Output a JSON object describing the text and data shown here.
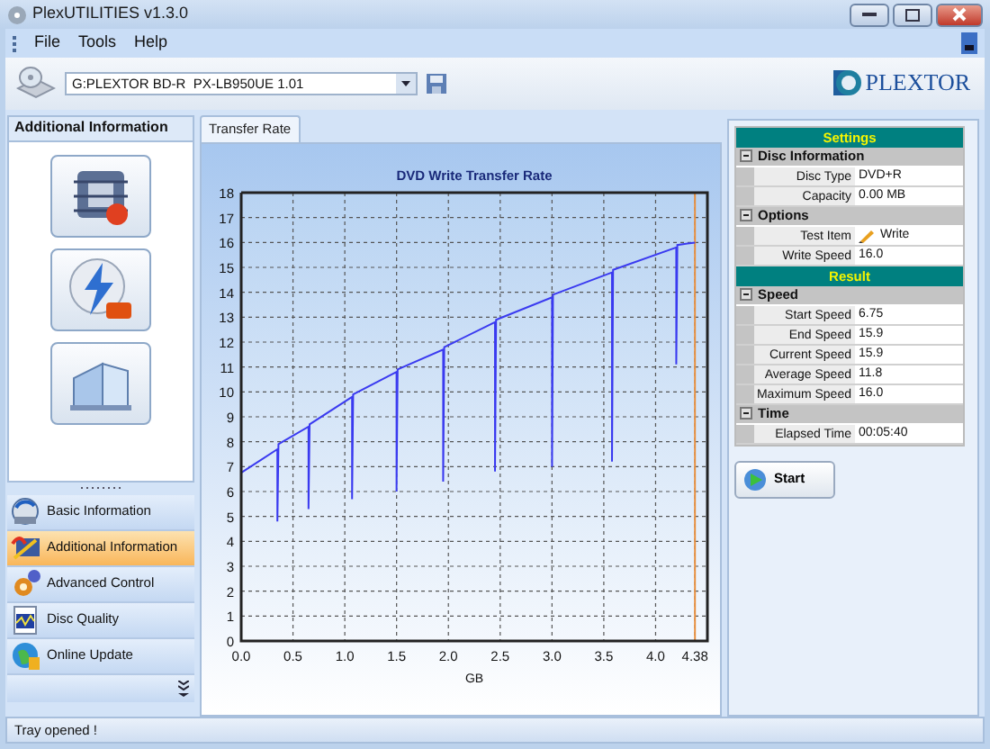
{
  "window": {
    "title": "PlexUTILITIES v1.3.0"
  },
  "menu": [
    "File",
    "Tools",
    "Help"
  ],
  "toolbar": {
    "drive": "G:PLEXTOR BD-R  PX-LB950UE 1.01",
    "logo": "PLEXTOR"
  },
  "sidebar": {
    "title": "Additional Information",
    "items": [
      {
        "label": "Basic Information",
        "selected": false
      },
      {
        "label": "Additional Information",
        "selected": true
      },
      {
        "label": "Advanced Control",
        "selected": false
      },
      {
        "label": "Disc Quality",
        "selected": false
      },
      {
        "label": "Online Update",
        "selected": false
      }
    ]
  },
  "tabs": [
    {
      "label": "Transfer Rate",
      "selected": true
    }
  ],
  "chart_data": {
    "type": "line",
    "title": "DVD Write Transfer Rate",
    "xlabel": "GB",
    "x": [
      0,
      0.35,
      0.35,
      0.36,
      0.65,
      0.65,
      0.66,
      1.07,
      1.07,
      1.08,
      1.5,
      1.5,
      1.51,
      1.95,
      1.95,
      1.96,
      2.45,
      2.45,
      2.46,
      3.0,
      3.0,
      3.01,
      3.58,
      3.58,
      3.59,
      4.2,
      4.2,
      4.21,
      4.38
    ],
    "values": [
      6.75,
      7.7,
      4.8,
      7.9,
      8.6,
      5.3,
      8.7,
      9.8,
      5.7,
      9.9,
      10.8,
      6.0,
      10.9,
      11.7,
      6.4,
      11.8,
      12.8,
      6.8,
      12.9,
      13.8,
      7.0,
      13.9,
      14.8,
      7.2,
      14.9,
      15.8,
      11.1,
      15.9,
      16.0
    ],
    "grid": true,
    "xlim": [
      0,
      4.5
    ],
    "ylim": [
      0,
      18
    ],
    "xticks": [
      {
        "value": 0,
        "label": "0.0"
      },
      {
        "value": 0.5,
        "label": "0.5"
      },
      {
        "value": 1,
        "label": "1.0"
      },
      {
        "value": 1.5,
        "label": "1.5"
      },
      {
        "value": 2,
        "label": "2.0"
      },
      {
        "value": 2.5,
        "label": "2.5"
      },
      {
        "value": 3,
        "label": "3.0"
      },
      {
        "value": 3.5,
        "label": "3.5"
      },
      {
        "value": 4,
        "label": "4.0"
      },
      {
        "value": 4.38,
        "label": "4.38"
      }
    ],
    "yticks": [
      0,
      1,
      2,
      3,
      4,
      5,
      6,
      7,
      8,
      9,
      10,
      11,
      12,
      13,
      14,
      15,
      16,
      17,
      18
    ],
    "ref_lines": [
      {
        "axis": "x",
        "value": 4.38
      }
    ]
  },
  "panels": [
    {
      "title": "Settings",
      "groups": [
        {
          "title": "Disc Information",
          "expanded": true,
          "rows": [
            {
              "kind": "text",
              "label": "Disc Type",
              "value": "DVD+R"
            },
            {
              "kind": "text",
              "label": "Capacity",
              "value": "0.00 MB"
            }
          ]
        },
        {
          "title": "Options",
          "expanded": true,
          "rows": [
            {
              "kind": "icon",
              "label": "Test Item",
              "value": "Write"
            },
            {
              "kind": "text",
              "label": "Write Speed",
              "value": "16.0"
            }
          ]
        }
      ]
    },
    {
      "title": "Result",
      "groups": [
        {
          "title": "Speed",
          "expanded": true,
          "rows": [
            {
              "kind": "text",
              "label": "Start Speed",
              "value": "6.75"
            },
            {
              "kind": "text",
              "label": "End Speed",
              "value": "15.9"
            },
            {
              "kind": "text",
              "label": "Current Speed",
              "value": "15.9"
            },
            {
              "kind": "text",
              "label": "Average Speed",
              "value": "11.8"
            },
            {
              "kind": "text",
              "label": "Maximum Speed",
              "value": "16.0"
            }
          ]
        },
        {
          "title": "Time",
          "expanded": true,
          "rows": [
            {
              "kind": "text",
              "label": "Elapsed Time",
              "value": "00:05:40"
            }
          ]
        }
      ]
    }
  ],
  "start_button": "Start",
  "status_bar": "Tray opened !"
}
